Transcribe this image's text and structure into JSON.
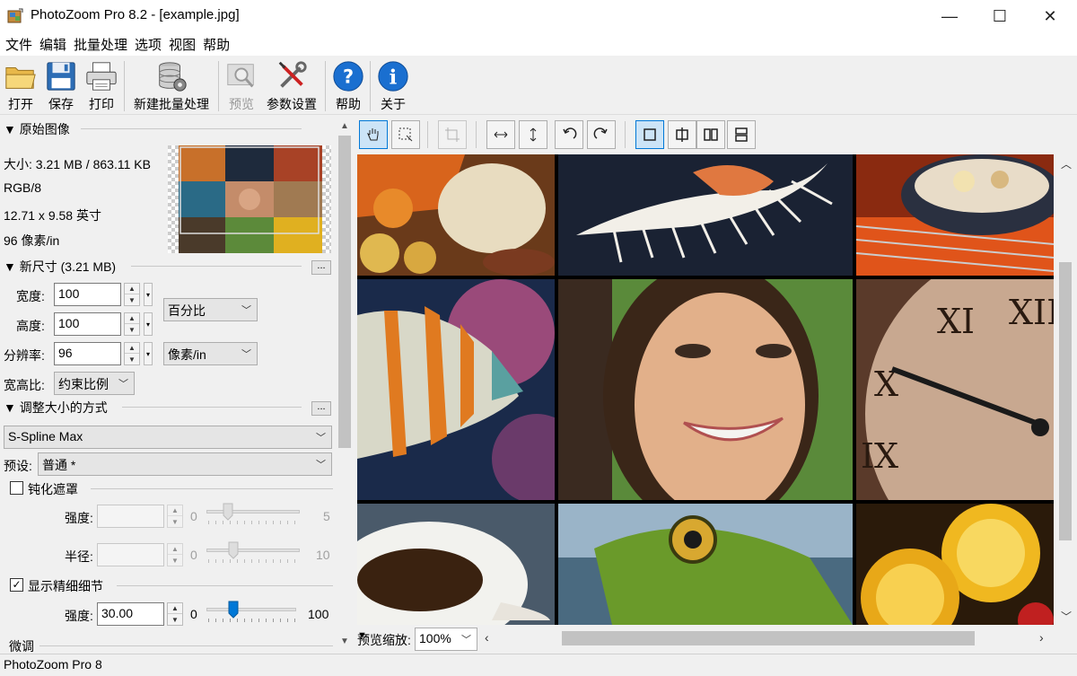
{
  "window": {
    "title": "PhotoZoom Pro 8.2 - [example.jpg]",
    "minimize": "—",
    "maximize": "☐",
    "close": "✕"
  },
  "menu": [
    "文件",
    "编辑",
    "批量处理",
    "选项",
    "视图",
    "帮助"
  ],
  "toolbar": {
    "open": "打开",
    "save": "保存",
    "print": "打印",
    "new_batch": "新建批量处理",
    "preview": "预览",
    "settings": "参数设置",
    "help": "帮助",
    "about": "关于"
  },
  "original": {
    "header": "▼ 原始图像",
    "size": "大小: 3.21 MB / 863.11 KB",
    "mode": "RGB/8",
    "dimensions": "12.71 x 9.58 英寸",
    "resolution": "96 像素/in"
  },
  "new_size": {
    "header": "▼ 新尺寸 (3.21 MB)",
    "dots": "...",
    "width_label": "宽度:",
    "width_value": "100",
    "height_label": "高度:",
    "height_value": "100",
    "unit": "百分比",
    "resolution_label": "分辨率:",
    "resolution_value": "96",
    "resolution_unit": "像素/in",
    "aspect_label": "宽高比:",
    "aspect_value": "约束比例"
  },
  "resize_method": {
    "header": "▼ 调整大小的方式",
    "dots": "...",
    "method": "S-Spline Max",
    "preset_label": "预设:",
    "preset_value": "普通 *"
  },
  "unsharp": {
    "label": "钝化遮罩",
    "checked": false,
    "strength_label": "强度:",
    "strength_min": "0",
    "strength_max": "5",
    "radius_label": "半径:",
    "radius_min": "0",
    "radius_max": "10"
  },
  "fine_detail": {
    "label": "显示精细细节",
    "checked": true,
    "check_mark": "✓",
    "strength_label": "强度:",
    "strength_value": "30.00",
    "min": "0",
    "max": "100",
    "level": 0.3
  },
  "fine_tune": {
    "label": "微调"
  },
  "preview_zoom": {
    "label": "预览缩放:",
    "value": "100%"
  },
  "status": {
    "text": "PhotoZoom Pro 8"
  },
  "colors": {
    "accent": "#0078d7",
    "help_icon": "#1a6fd0"
  }
}
